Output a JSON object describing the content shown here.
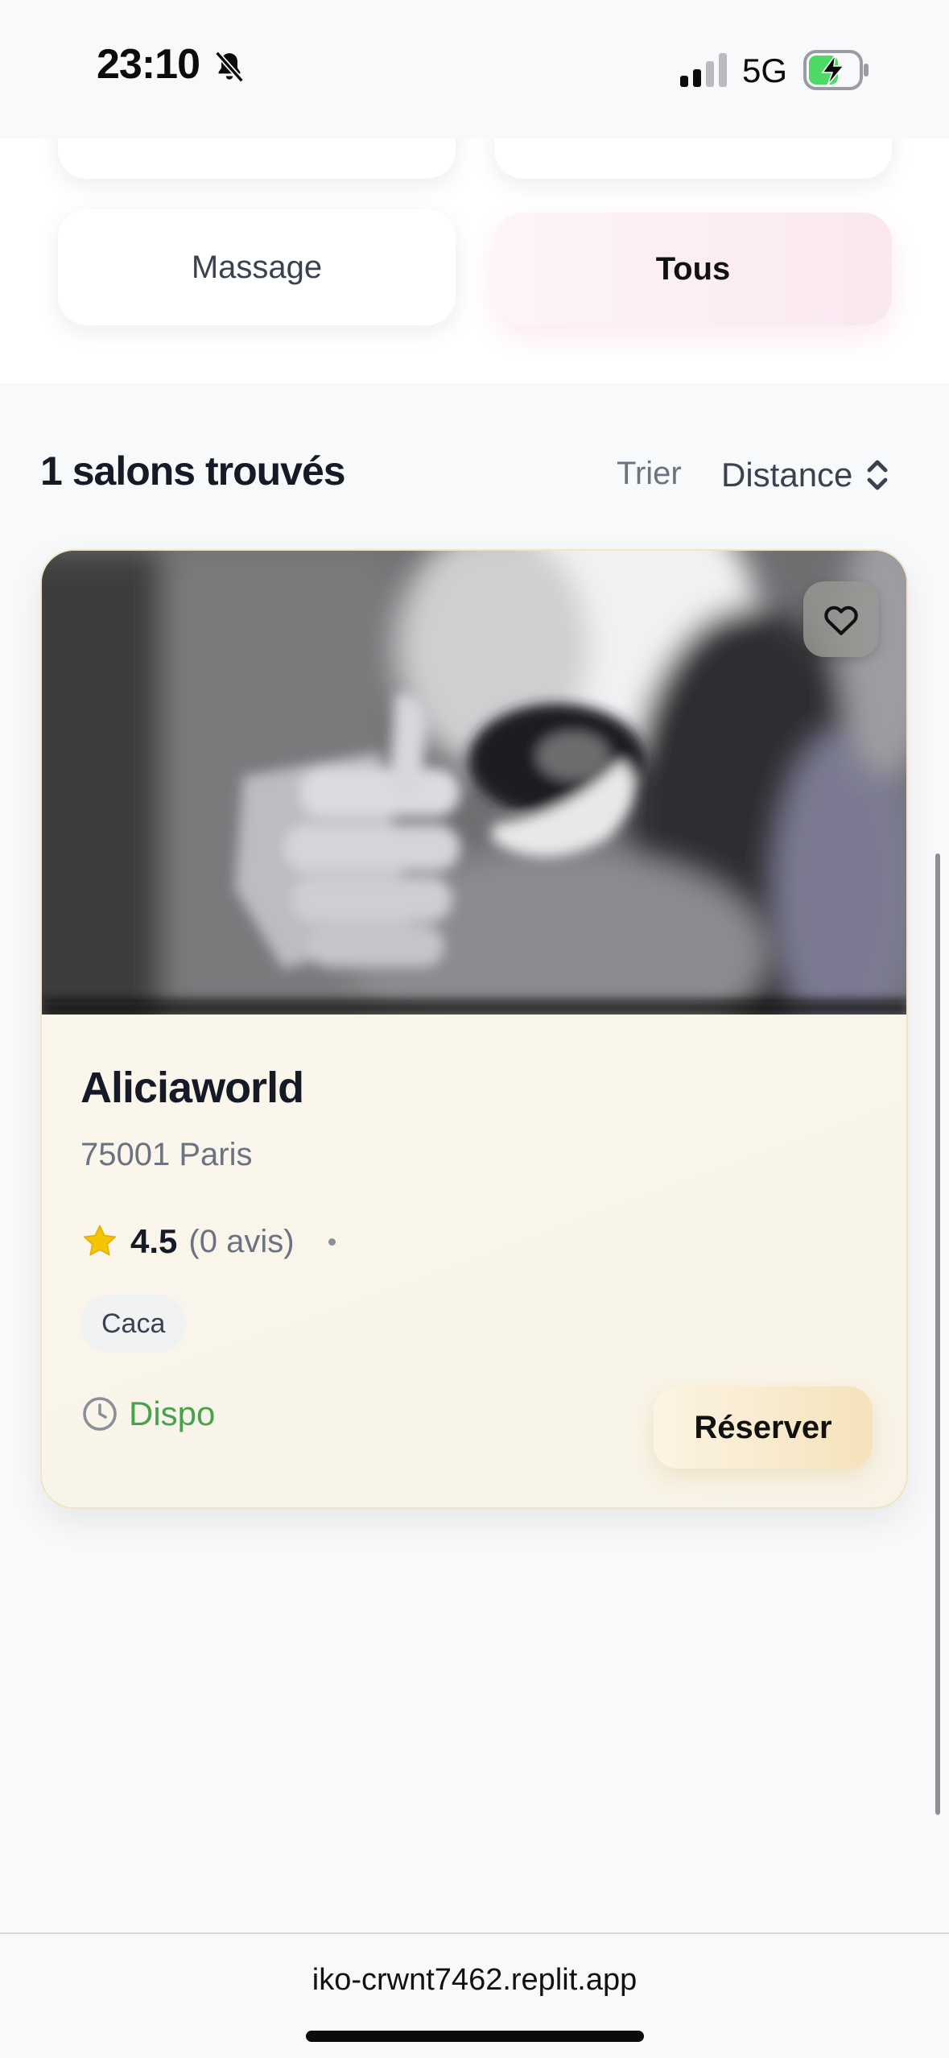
{
  "status_bar": {
    "time": "23:10",
    "network": "5G",
    "icons": [
      "bell-slash-icon",
      "signal-icon",
      "battery-charging-icon"
    ]
  },
  "filters": {
    "items": [
      {
        "label": "Massage",
        "selected": false
      },
      {
        "label": "Tous",
        "selected": true
      }
    ]
  },
  "results": {
    "count_label": "1 salons trouvés",
    "sort_label": "Trier",
    "sort_value": "Distance"
  },
  "salon": {
    "name": "Aliciaworld",
    "address": "75001 Paris",
    "rating": "4.5",
    "reviews": "(0 avis)",
    "tag": "Caca",
    "availability": "Dispo",
    "reserve_label": "Réserver",
    "favorited": false
  },
  "colors": {
    "accent_pink": "#fae7f0",
    "card_bg": "#faf6ec",
    "available_green": "#4aa14c",
    "star_yellow": "#f5c400",
    "reserve_gold": "#f6e2bb"
  },
  "browser": {
    "url": "iko-crwnt7462.replit.app"
  }
}
